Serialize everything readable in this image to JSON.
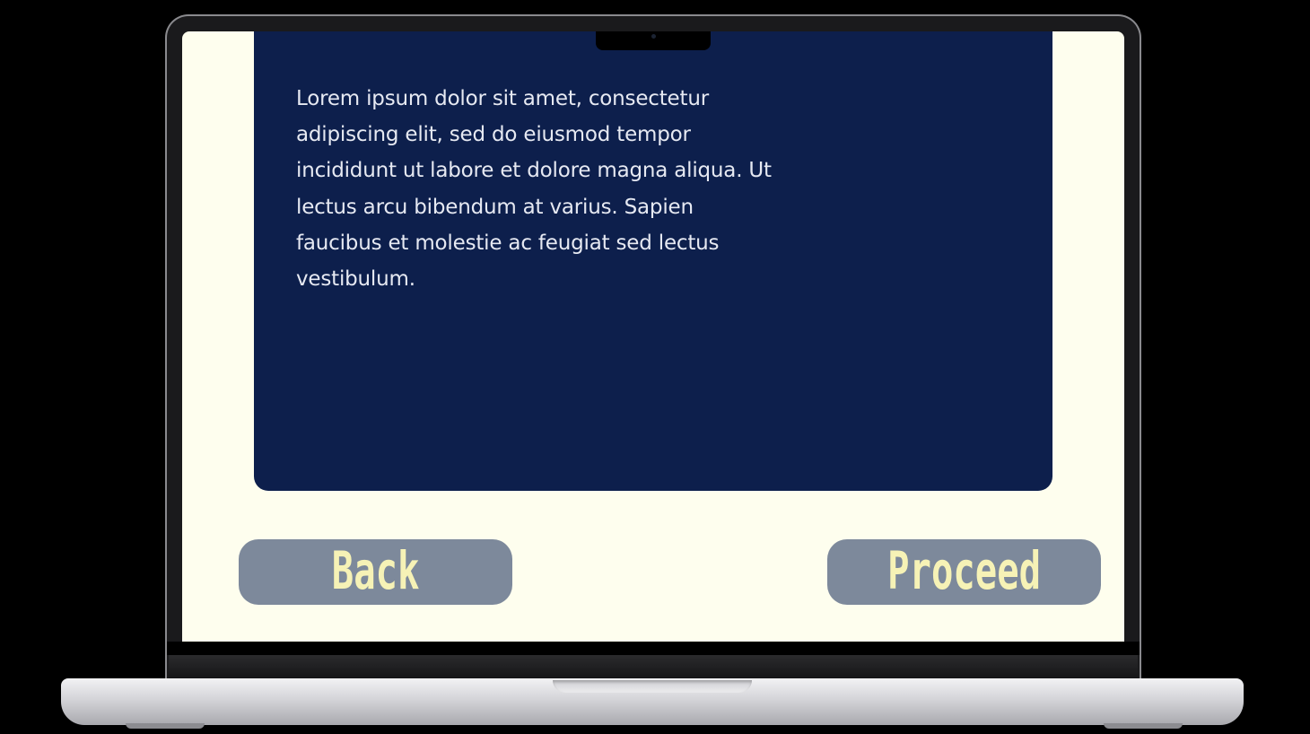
{
  "screen": {
    "background_color": "#fefeee",
    "card_color": "#0d1f4c",
    "body_text": "Lorem ipsum dolor sit amet, consectetur adipiscing elit, sed do eiusmod tempor incididunt ut labore et dolore magna aliqua. Ut lectus arcu bibendum at varius. Sapien faucibus et molestie ac feugiat sed lectus vestibulum."
  },
  "buttons": {
    "back_label": "Back",
    "proceed_label": "Proceed",
    "button_color": "#7d899b",
    "button_text_color": "#f6f2b6"
  },
  "device": {
    "frame": "laptop-mockup"
  }
}
